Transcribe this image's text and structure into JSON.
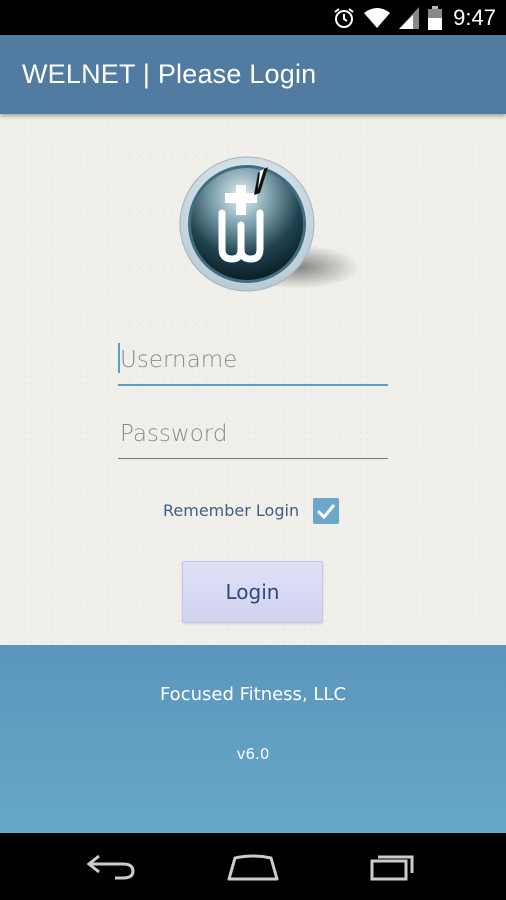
{
  "status_bar": {
    "time": "9:47",
    "icons": [
      "alarm-icon",
      "wifi-icon",
      "cell-signal-icon",
      "battery-icon"
    ]
  },
  "action_bar": {
    "title": "WELNET | Please Login"
  },
  "logo": {
    "icon": "welnet-logo-icon"
  },
  "form": {
    "username": {
      "value": "",
      "placeholder": "Username"
    },
    "password": {
      "value": "",
      "placeholder": "Password"
    },
    "remember_label": "Remember Login",
    "remember_checked": true,
    "login_label": "Login"
  },
  "footer": {
    "company": "Focused Fitness, LLC",
    "version": "v6.0"
  },
  "nav_bar": {
    "icons": [
      "back-icon",
      "home-icon",
      "recents-icon"
    ]
  },
  "colors": {
    "action_bar": "#527ba1",
    "accent": "#5b9ec4",
    "footer": "#629fc3",
    "button_bg": "#d8d9f4"
  }
}
